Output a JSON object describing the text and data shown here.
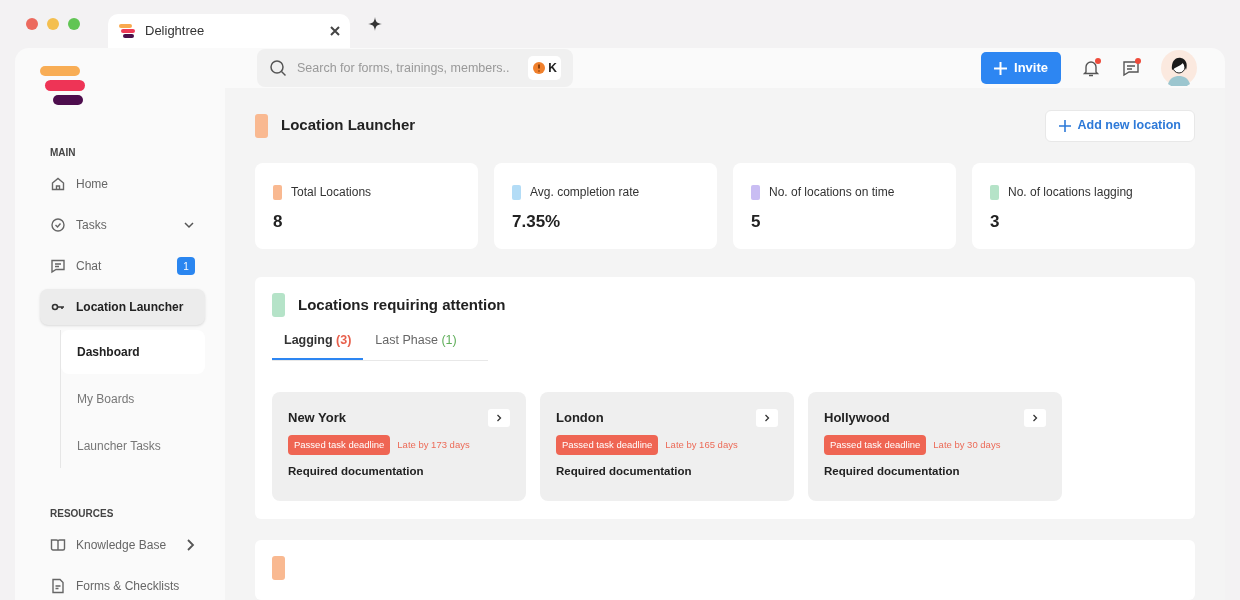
{
  "browser": {
    "tab_title": "Delightree"
  },
  "search": {
    "placeholder": "Search for forms, trainings, members..",
    "shortcut_key": "K"
  },
  "header": {
    "invite_label": "Invite",
    "notifications_unread": true,
    "messages_unread": true
  },
  "sidebar": {
    "sections": [
      {
        "title": "MAIN",
        "items": [
          {
            "label": "Home",
            "selected": false
          },
          {
            "label": "Tasks",
            "selected": false,
            "expanded": false
          },
          {
            "label": "Chat",
            "selected": false,
            "badge": "1"
          },
          {
            "label": "Location Launcher",
            "selected": true,
            "children": [
              {
                "label": "Dashboard",
                "selected": true
              },
              {
                "label": "My Boards",
                "selected": false
              },
              {
                "label": "Launcher Tasks",
                "selected": false
              }
            ]
          }
        ]
      },
      {
        "title": "RESOURCES",
        "items": [
          {
            "label": "Knowledge Base",
            "selected": false,
            "arrow": true
          },
          {
            "label": "Forms & Checklists",
            "selected": false
          }
        ]
      }
    ]
  },
  "page": {
    "title": "Location Launcher",
    "add_button": "Add new location"
  },
  "stats": [
    {
      "label": "Total Locations",
      "value": "8",
      "color": "#f9b991"
    },
    {
      "label": "Avg. completion rate",
      "value": "7.35%",
      "color": "#b3dcf6"
    },
    {
      "label": "No. of locations on time",
      "value": "5",
      "color": "#c9bdf3"
    },
    {
      "label": "No. of locations lagging",
      "value": "3",
      "color": "#b5e3c8"
    }
  ],
  "attention": {
    "title": "Locations requiring attention",
    "tabs": [
      {
        "label": "Lagging",
        "count": "(3)",
        "selected": true,
        "color": "#e8604c"
      },
      {
        "label": "Last Phase",
        "count": "(1)",
        "selected": false,
        "color": "#5fae5a"
      }
    ],
    "cards": [
      {
        "name": "New York",
        "status": "Passed task deadline",
        "late": "Late by 173 days",
        "requirement": "Required documentation"
      },
      {
        "name": "London",
        "status": "Passed task deadline",
        "late": "Late by 165 days",
        "requirement": "Required documentation"
      },
      {
        "name": "Hollywood",
        "status": "Passed task deadline",
        "late": "Late by 30 days",
        "requirement": "Required documentation"
      }
    ]
  }
}
